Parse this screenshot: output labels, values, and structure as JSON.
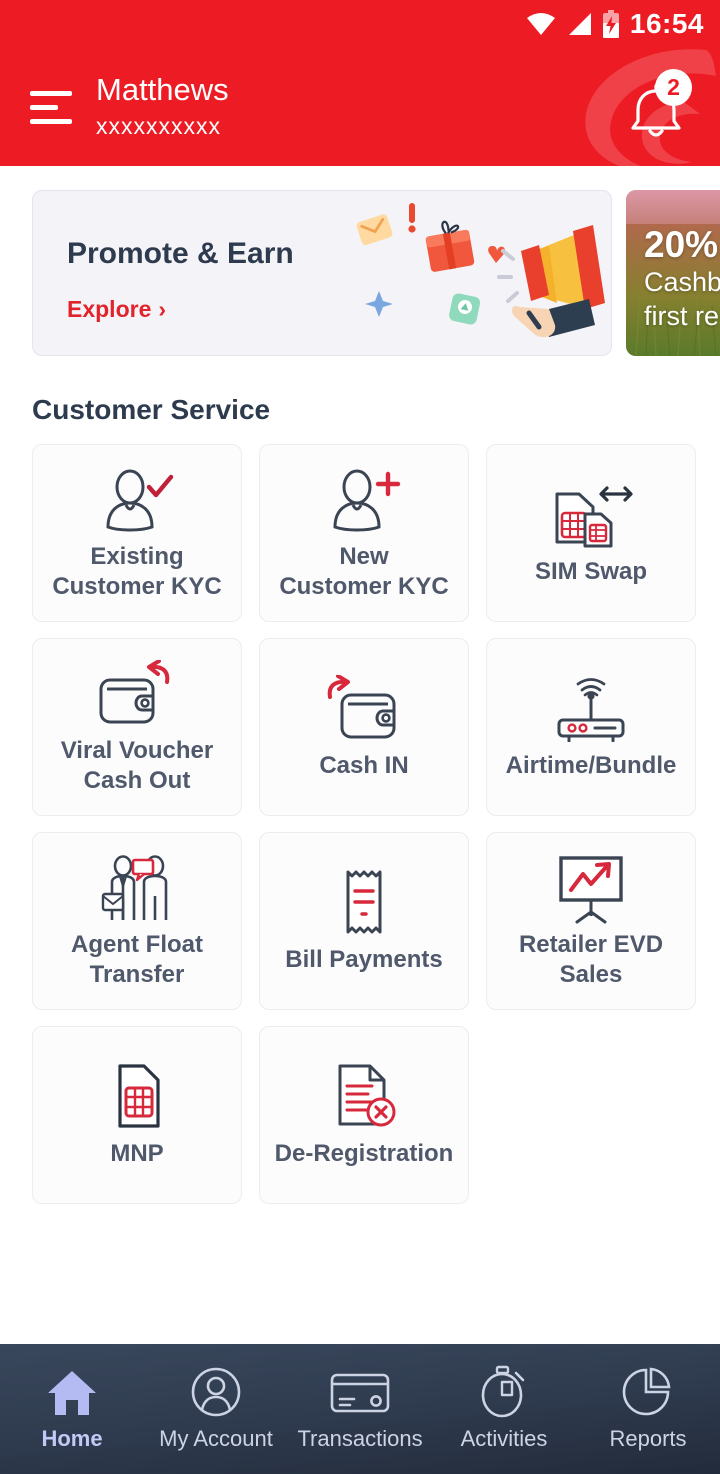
{
  "brand": {
    "primary": "#ed1c24",
    "accent_red": "#e1232b",
    "dark": "#2e3a4d",
    "nav_active": "#c3c8f5"
  },
  "statusbar": {
    "time": "16:54",
    "icons": [
      "wifi-icon",
      "cellular-signal-icon",
      "battery-charging-icon"
    ]
  },
  "header": {
    "menu_icon": "hamburger-menu-icon",
    "user_name": "Matthews",
    "user_msisdn": "xxxxxxxxxx",
    "bell_icon": "notification-bell-icon",
    "bell_badge": "2"
  },
  "banners": {
    "promote": {
      "title": "Promote & Earn",
      "cta": "Explore",
      "cta_chevron": "›"
    },
    "cashback": {
      "percent": "20%",
      "line1": "Cashb",
      "line2": "first re"
    }
  },
  "section": {
    "title": "Customer Service"
  },
  "tiles": [
    {
      "label": "Existing\nCustomer KYC",
      "icon": "user-check-icon"
    },
    {
      "label": "New\nCustomer KYC",
      "icon": "user-plus-icon"
    },
    {
      "label": "SIM Swap",
      "icon": "sim-swap-icon"
    },
    {
      "label": "Viral Voucher\nCash Out",
      "icon": "wallet-out-icon"
    },
    {
      "label": "Cash IN",
      "icon": "wallet-in-icon"
    },
    {
      "label": "Airtime/Bundle",
      "icon": "router-icon"
    },
    {
      "label": "Agent Float\nTransfer",
      "icon": "agent-transfer-icon"
    },
    {
      "label": "Bill Payments",
      "icon": "receipt-icon"
    },
    {
      "label": "Retailer EVD\nSales",
      "icon": "sales-chart-icon"
    },
    {
      "label": "MNP",
      "icon": "sim-card-icon"
    },
    {
      "label": "De-Registration",
      "icon": "document-remove-icon"
    }
  ],
  "bottom_nav": [
    {
      "label": "Home",
      "icon": "home-icon",
      "active": true
    },
    {
      "label": "My Account",
      "icon": "user-circle-icon",
      "active": false
    },
    {
      "label": "Transactions",
      "icon": "credit-card-icon",
      "active": false
    },
    {
      "label": "Activities",
      "icon": "stopwatch-icon",
      "active": false
    },
    {
      "label": "Reports",
      "icon": "pie-chart-icon",
      "active": false
    }
  ]
}
